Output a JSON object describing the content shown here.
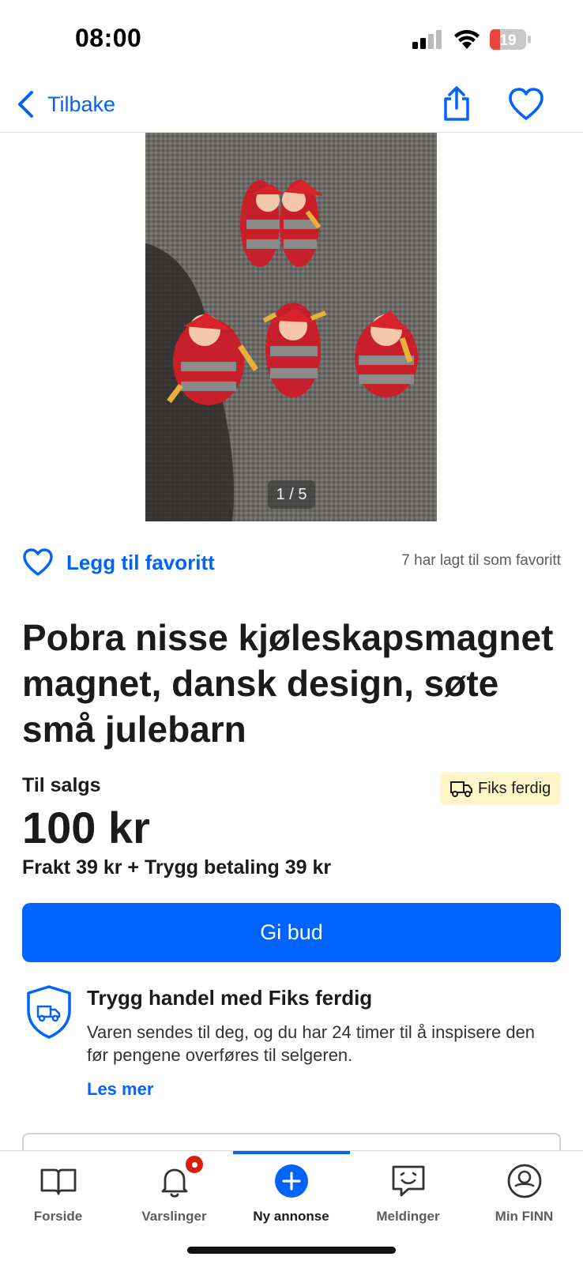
{
  "status_bar": {
    "time": "08:00",
    "battery": "19"
  },
  "nav": {
    "back_label": "Tilbake"
  },
  "gallery": {
    "counter": "1 / 5"
  },
  "favorite": {
    "label": "Legg til favoritt",
    "count_text": "7 har lagt til som favoritt"
  },
  "listing": {
    "title": "Pobra nisse kjøleskapsmagnet magnet, dansk design, søte små julebarn",
    "sale_type": "Til salgs",
    "badge": "Fiks ferdig",
    "price": "100 kr",
    "shipping": "Frakt 39 kr + Trygg betaling 39 kr",
    "bid_button": "Gi bud"
  },
  "safe_trade": {
    "title": "Trygg handel med Fiks ferdig",
    "description": "Varen sendes til deg, og du har 24 timer til å inspisere den før pengene overføres til selgeren.",
    "read_more": "Les mer"
  },
  "tabs": [
    {
      "label": "Forside",
      "icon": "book-icon"
    },
    {
      "label": "Varslinger",
      "icon": "bell-icon"
    },
    {
      "label": "Ny annonse",
      "icon": "plus-circle-icon"
    },
    {
      "label": "Meldinger",
      "icon": "chat-icon"
    },
    {
      "label": "Min FINN",
      "icon": "profile-icon"
    }
  ],
  "colors": {
    "accent": "#0063fb",
    "badge_bg": "#fef6c8",
    "battery_low": "#e8453c",
    "notification": "#d91f0a"
  }
}
